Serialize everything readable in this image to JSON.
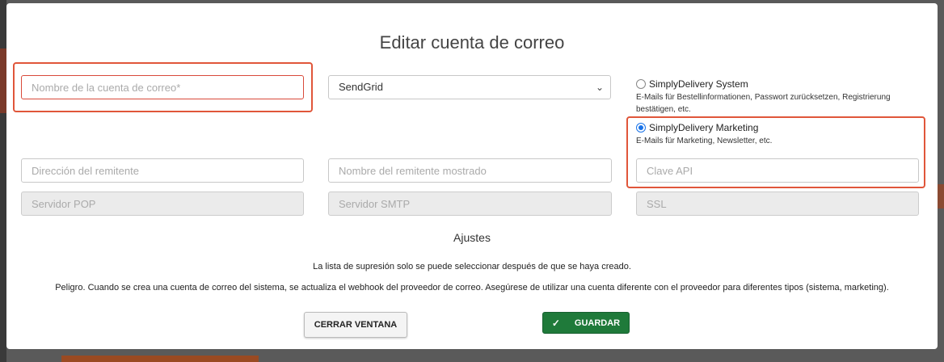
{
  "modal": {
    "title": "Editar cuenta de correo",
    "fields": {
      "account_name_placeholder": "Nombre de la cuenta de correo*",
      "provider_value": "SendGrid",
      "sender_address_placeholder": "Dirección del remitente",
      "sender_name_placeholder": "Nombre del remitente mostrado",
      "api_key_placeholder": "Clave API",
      "pop_server_placeholder": "Servidor POP",
      "smtp_server_placeholder": "Servidor SMTP",
      "ssl_placeholder": "SSL"
    },
    "account_type": {
      "system_label": "SimplyDelivery System",
      "system_desc": "E-Mails für Bestellinformationen, Passwort zurücksetzen, Registrierung bestätigen, etc.",
      "marketing_label": "SimplyDelivery Marketing",
      "marketing_desc": "E-Mails für Marketing, Newsletter, etc.",
      "selected": "marketing"
    },
    "settings_title": "Ajustes",
    "note_suppression": "La lista de supresión solo se puede seleccionar después de que se haya creado.",
    "note_danger": "Peligro. Cuando se crea una cuenta de correo del sistema, se actualiza el webhook del proveedor de correo. Asegúrese de utilizar una cuenta diferente con el proveedor para diferentes tipos (sistema, marketing).",
    "close_label": "CERRAR VENTANA",
    "save_label": "GUARDAR",
    "save_icon": "check-icon"
  },
  "colors": {
    "highlight": "#e0563a",
    "save_button": "#1f7a3a",
    "radio_selected": "#1a73e8"
  }
}
